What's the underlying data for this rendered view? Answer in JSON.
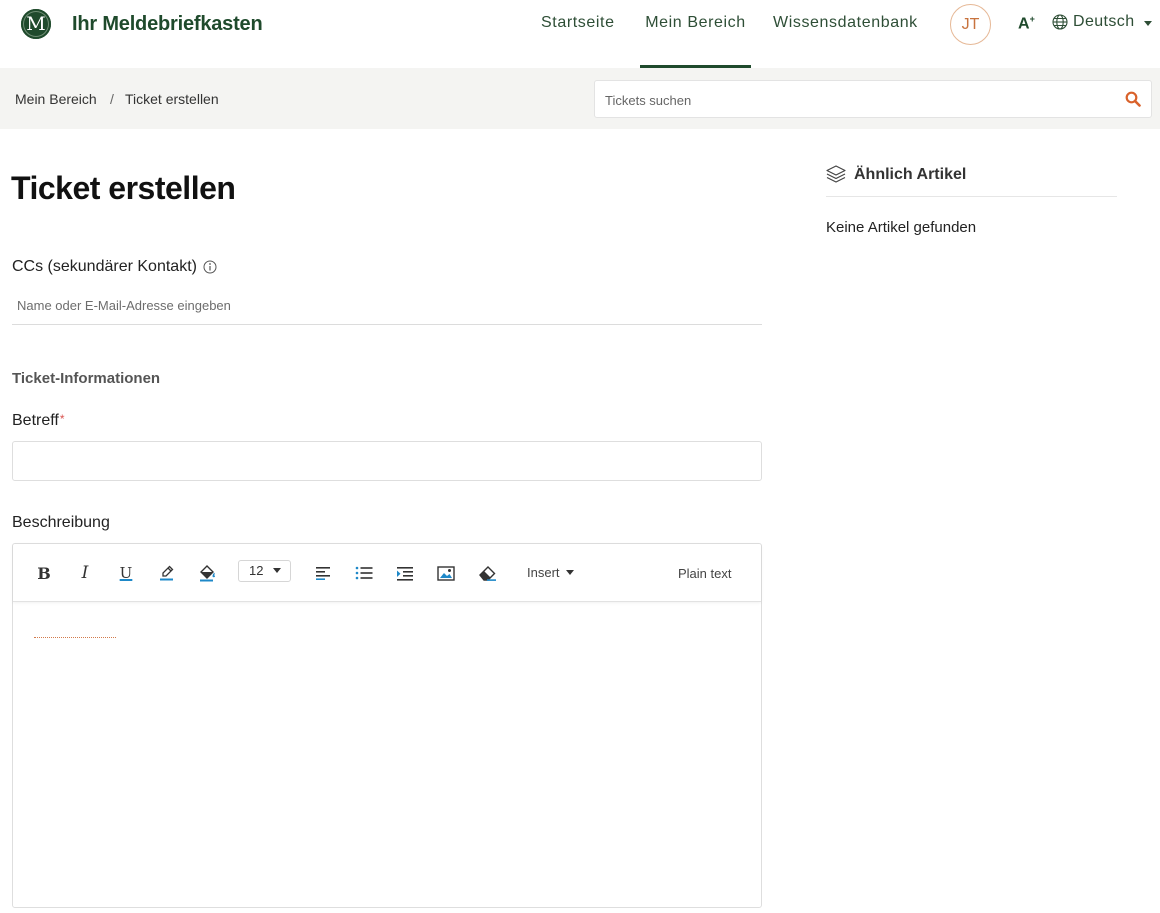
{
  "header": {
    "logo_letter": "M",
    "brand": "Ihr Meldebriefkasten",
    "nav": [
      {
        "label": "Startseite",
        "active": false
      },
      {
        "label": "Mein Bereich",
        "active": true
      },
      {
        "label": "Wissensdatenbank",
        "active": false
      }
    ],
    "avatar_initials": "JT",
    "font_size_label": "A",
    "font_size_sup": "+",
    "language": "Deutsch"
  },
  "breadcrumb": {
    "home": "Mein Bereich",
    "separator": "/",
    "current": "Ticket erstellen"
  },
  "search": {
    "placeholder": "Tickets suchen"
  },
  "form": {
    "title": "Ticket erstellen",
    "cc_label": "CCs (sekundärer Kontakt)",
    "cc_placeholder": "Name oder E-Mail-Adresse eingeben",
    "section_title": "Ticket-Informationen",
    "subject_label": "Betreff",
    "required_mark": "*",
    "subject_value": "",
    "description_label": "Beschreibung"
  },
  "editor": {
    "bold": "B",
    "italic": "I",
    "underline": "U",
    "font_size": "12",
    "insert_label": "Insert",
    "plain_text_label": "Plain text"
  },
  "sidebar": {
    "title": "Ähnlich Artikel",
    "empty_text": "Keine Artikel gefunden"
  },
  "colors": {
    "brand_green": "#1f4a2c",
    "accent_orange": "#d9622b",
    "toolbar_blue": "#1e88c8"
  }
}
